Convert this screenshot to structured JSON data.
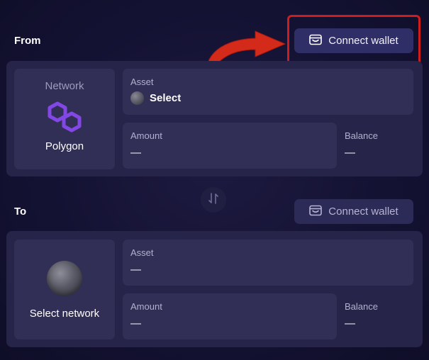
{
  "from": {
    "label": "From",
    "connect_label": "Connect wallet",
    "network": {
      "title": "Network",
      "name": "Polygon",
      "icon": "polygon-icon"
    },
    "asset": {
      "label": "Asset",
      "value": "Select"
    },
    "amount": {
      "label": "Amount",
      "value": "—"
    },
    "balance": {
      "label": "Balance",
      "value": "—"
    }
  },
  "to": {
    "label": "To",
    "connect_label": "Connect wallet",
    "network": {
      "select_label": "Select network"
    },
    "asset": {
      "label": "Asset",
      "value": "—"
    },
    "amount": {
      "label": "Amount",
      "value": "—"
    },
    "balance": {
      "label": "Balance",
      "value": "—"
    }
  },
  "swap": {
    "icon": "swap-vertical-icon"
  },
  "colors": {
    "accent": "#302e66",
    "polygon": "#8247e5",
    "highlight": "#cf1d1d",
    "annotation_arrow": "#d32a1a"
  }
}
